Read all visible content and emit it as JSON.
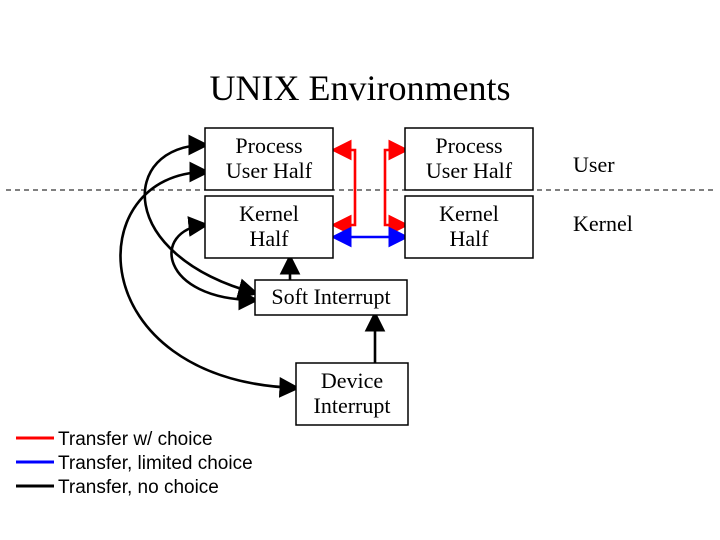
{
  "title": "UNIX Environments",
  "boxes": {
    "process_user_half_left": {
      "line1": "Process",
      "line2": "User Half"
    },
    "process_user_half_right": {
      "line1": "Process",
      "line2": "User Half"
    },
    "kernel_half_left": {
      "line1": "Kernel",
      "line2": "Half"
    },
    "kernel_half_right": {
      "line1": "Kernel",
      "line2": "Half"
    },
    "soft_interrupt": "Soft Interrupt",
    "device_interrupt": {
      "line1": "Device",
      "line2": "Interrupt"
    }
  },
  "side_labels": {
    "user": "User",
    "kernel": "Kernel"
  },
  "legend": {
    "red": "Transfer w/ choice",
    "blue": "Transfer, limited choice",
    "black": "Transfer, no choice"
  },
  "colors": {
    "red": "#ff0000",
    "blue": "#0000ff",
    "black": "#000000"
  }
}
